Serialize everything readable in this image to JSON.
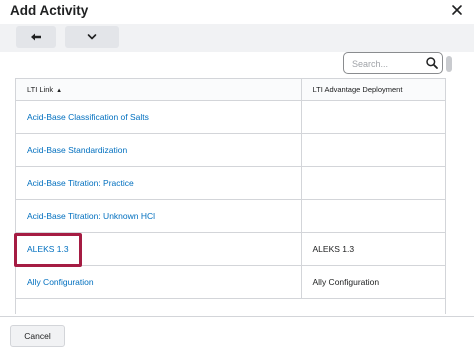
{
  "dialog": {
    "title": "Add Activity",
    "close_icon": "close-icon"
  },
  "toolbar": {
    "back_icon": "arrow-left-icon",
    "more_icon": "chevron-down-icon"
  },
  "search": {
    "placeholder": "Search...",
    "icon": "search-icon"
  },
  "table": {
    "headers": [
      {
        "label": "LTI Link",
        "sort_icon": "sort-ascending-icon"
      },
      {
        "label": "LTI Advantage Deployment"
      }
    ],
    "rows": [
      {
        "link": "Acid-Base Classification of Salts",
        "deployment": ""
      },
      {
        "link": "Acid-Base Standardization",
        "deployment": ""
      },
      {
        "link": "Acid-Base Titration: Practice",
        "deployment": ""
      },
      {
        "link": "Acid-Base Titration: Unknown HCl",
        "deployment": ""
      },
      {
        "link": "ALEKS 1.3",
        "deployment": "ALEKS 1.3"
      },
      {
        "link": "Ally Configuration",
        "deployment": "Ally Configuration"
      }
    ]
  },
  "footer": {
    "cancel_label": "Cancel"
  },
  "colors": {
    "link": "#006fbf",
    "highlight": "#a51c43",
    "toolbar_bg": "#f1f2f4"
  }
}
